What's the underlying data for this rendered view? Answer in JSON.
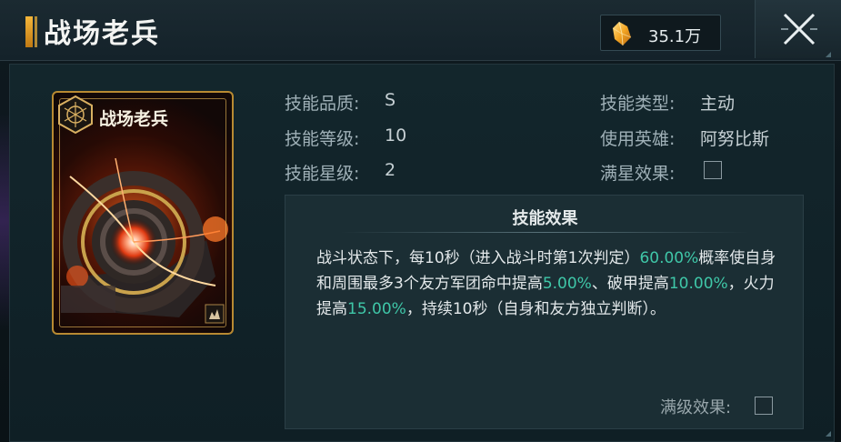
{
  "header": {
    "title": "战场老兵",
    "currency_icon": "crystal-icon",
    "currency_amount": "35.1万",
    "close_icon": "close-icon"
  },
  "card": {
    "name": "战场老兵",
    "badge_icon": "skill-emblem-icon",
    "corner_icon": "fire-rank-icon"
  },
  "info": {
    "quality_label": "技能品质:",
    "quality_value": "S",
    "level_label": "技能等级:",
    "level_value": "10",
    "star_label": "技能星级:",
    "star_value": "2",
    "type_label": "技能类型:",
    "type_value": "主动",
    "hero_label": "使用英雄:",
    "hero_value": "阿努比斯",
    "max_star_label": "满星效果:",
    "max_star_checked": false
  },
  "effect": {
    "title": "技能效果",
    "seg1": "战斗状态下，每10秒（进入战斗时第1次判定）",
    "val1": "60.00%",
    "seg2": "概率使自身和周围最多3个友方军团命中提高",
    "val2": "5.00%",
    "seg3": "、破甲提高",
    "val3": "10.00%",
    "seg4": "，火力提高",
    "val4": "15.00%",
    "seg5": "，持续10秒（自身和友方独立判断）。",
    "max_level_label": "满级效果:",
    "max_level_checked": false
  },
  "colors": {
    "highlight": "#3fc7a8",
    "title_accent": "#f5b63a",
    "card_border": "#b88a32"
  }
}
